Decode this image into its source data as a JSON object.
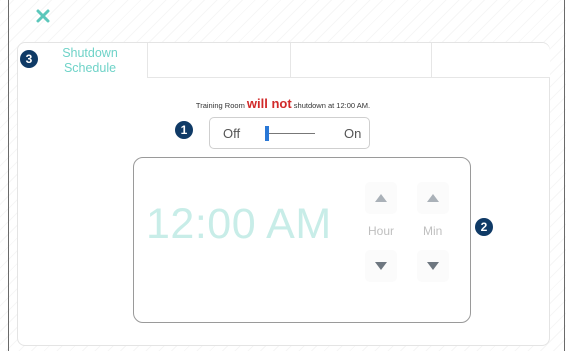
{
  "window": {
    "close_icon": "close-icon"
  },
  "tabs": [
    {
      "label": "Shutdown Schedule",
      "badge": "3",
      "active": true
    },
    {
      "label": ""
    },
    {
      "label": ""
    },
    {
      "label": ""
    }
  ],
  "status": {
    "prefix": "Training Room ",
    "emphasis": "will not",
    "suffix": " shutdown at 12:00 AM.",
    "emphasis_color": "#d12a2a"
  },
  "toggle": {
    "badge": "1",
    "off_label": "Off",
    "on_label": "On",
    "value": "off"
  },
  "clock": {
    "badge": "2",
    "time": "12:00 AM",
    "hour_label": "Hour",
    "min_label": "Min",
    "icons": {
      "up": "triangle-up-icon",
      "down": "triangle-down-icon"
    }
  },
  "colors": {
    "accent": "#6fd3c8",
    "badge": "#0f3a66",
    "thumb": "#2a78d6"
  }
}
